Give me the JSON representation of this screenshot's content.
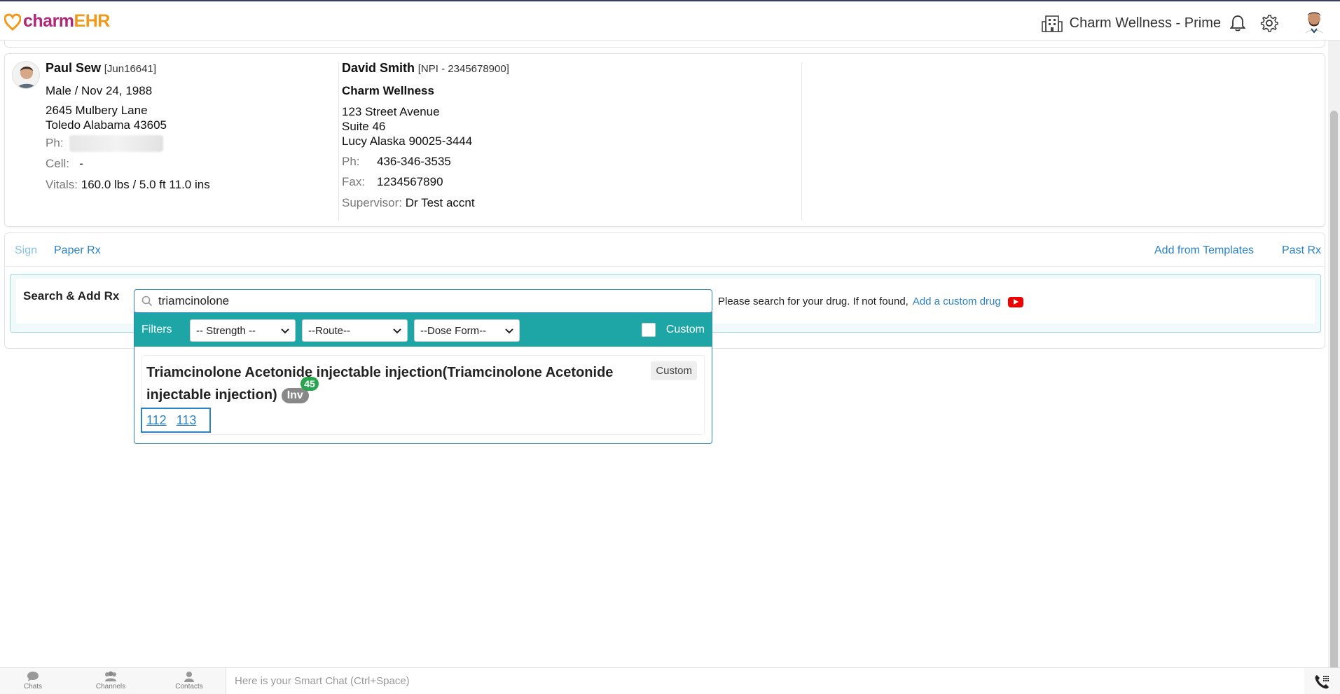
{
  "header": {
    "logo_charm": "charm",
    "logo_ehr": "EHR",
    "clinic_name": "Charm Wellness - Prime"
  },
  "patient": {
    "name": "Paul Sew",
    "id": "[Jun16641]",
    "gender_dob": "Male / Nov 24, 1988",
    "address1": "2645 Mulbery Lane",
    "address2": "Toledo Alabama 43605",
    "ph_label": "Ph:",
    "cell_label": "Cell:",
    "cell_value": "-",
    "vitals_label": "Vitals:",
    "vitals_value": "160.0 lbs / 5.0 ft 11.0 ins"
  },
  "provider": {
    "name": "David Smith",
    "npi": "[NPI - 2345678900]",
    "practice": "Charm Wellness",
    "address1": "123 Street Avenue",
    "address2": "Suite 46",
    "address3": "Lucy Alaska 90025-3444",
    "ph_label": "Ph:",
    "ph_value": "436-346-3535",
    "fax_label": "Fax:",
    "fax_value": "1234567890",
    "supervisor_label": "Supervisor:",
    "supervisor_value": "Dr Test accnt"
  },
  "tabs": {
    "sign": "Sign",
    "paper_rx": "Paper Rx",
    "add_from_templates": "Add from Templates",
    "past_rx": "Past Rx"
  },
  "search": {
    "label": "Search & Add Rx",
    "value": "triamcinolone",
    "hint": "Please search for your drug. If not found,",
    "custom_link": "Add a custom drug"
  },
  "filters": {
    "label": "Filters",
    "strength": "-- Strength --",
    "route": "--Route--",
    "dose_form": "--Dose Form--",
    "custom": "Custom"
  },
  "result": {
    "title": "Triamcinolone Acetonide injectable injection(Triamcinolone Acetonide injectable injection)",
    "inv": "Inv",
    "count": "45",
    "tag": "Custom",
    "codes": [
      "112",
      "113"
    ]
  },
  "bottombar": {
    "chats": "Chats",
    "channels": "Channels",
    "contacts": "Contacts",
    "smart_chat_placeholder": "Here is your Smart Chat (Ctrl+Space)"
  },
  "colors": {
    "brand_magenta": "#b0287a",
    "brand_orange": "#f09a1c",
    "link_blue": "#2a82c7",
    "filter_teal": "#1ea5a5",
    "count_green": "#2aa44f"
  },
  "icons": [
    "heart-logo-icon",
    "building-icon",
    "bell-icon",
    "gear-icon",
    "search-icon",
    "youtube-icon",
    "chat-icon",
    "channels-icon",
    "contacts-icon",
    "phone-icon"
  ]
}
